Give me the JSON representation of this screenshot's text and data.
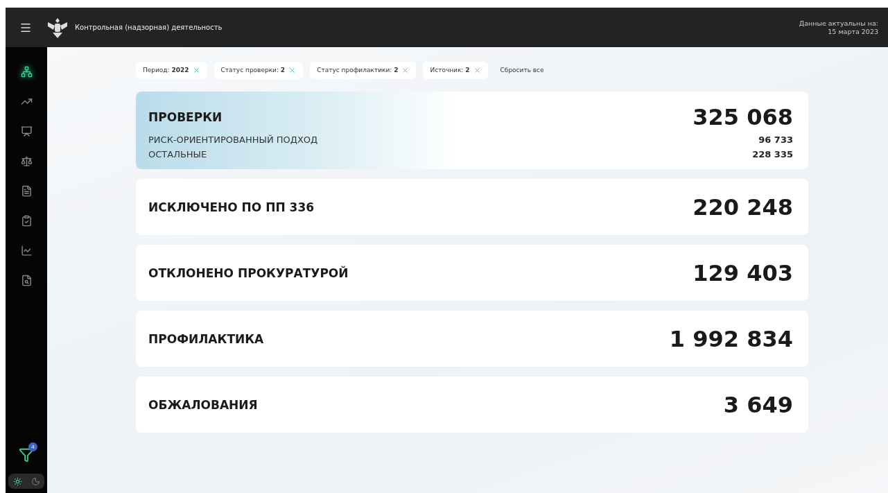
{
  "header": {
    "title": "Контрольная (надзорная) деятельность",
    "updated_label": "Данные актуальны на:",
    "updated_date": "15 марта 2023"
  },
  "sidebar": {
    "items": [
      {
        "kind": "structure",
        "selected": true
      },
      {
        "kind": "trend",
        "selected": false
      },
      {
        "kind": "monitor",
        "selected": false
      },
      {
        "kind": "scales",
        "selected": false
      },
      {
        "kind": "document",
        "selected": false
      },
      {
        "kind": "clipboard",
        "selected": false
      },
      {
        "kind": "chart",
        "selected": false
      },
      {
        "kind": "search-doc",
        "selected": false
      }
    ],
    "filter_badge": "4",
    "theme": [
      {
        "kind": "light",
        "selected": true
      },
      {
        "kind": "dark",
        "selected": false
      }
    ]
  },
  "filters": [
    {
      "label": "Период:",
      "value": "2022"
    },
    {
      "label": "Статус проверки:",
      "value": "2"
    },
    {
      "label": "Статус профилактики:",
      "value": "2"
    },
    {
      "label": "Источник:",
      "value": "2"
    }
  ],
  "reset_label": "Сбросить все",
  "cards": [
    {
      "title": "ПРОВЕРКИ",
      "value": "325 068",
      "highlighted": true,
      "rows": [
        {
          "label": "РИСК-ОРИЕНТИРОВАННЫЙ ПОДХОД",
          "value": "96 733"
        },
        {
          "label": "ОСТАЛЬНЫЕ",
          "value": "228 335"
        }
      ]
    },
    {
      "title": "ИСКЛЮЧЕНО ПО ПП 336",
      "value": "220 248",
      "highlighted": false
    },
    {
      "title": "ОТКЛОНЕНО ПРОКУРАТУРОЙ",
      "value": "129 403",
      "highlighted": false
    },
    {
      "title": "ПРОФИЛАКТИКА",
      "value": "1 992 834",
      "highlighted": false
    },
    {
      "title": "ОБЖАЛОВАНИЯ",
      "value": "3 649",
      "highlighted": false
    }
  ]
}
